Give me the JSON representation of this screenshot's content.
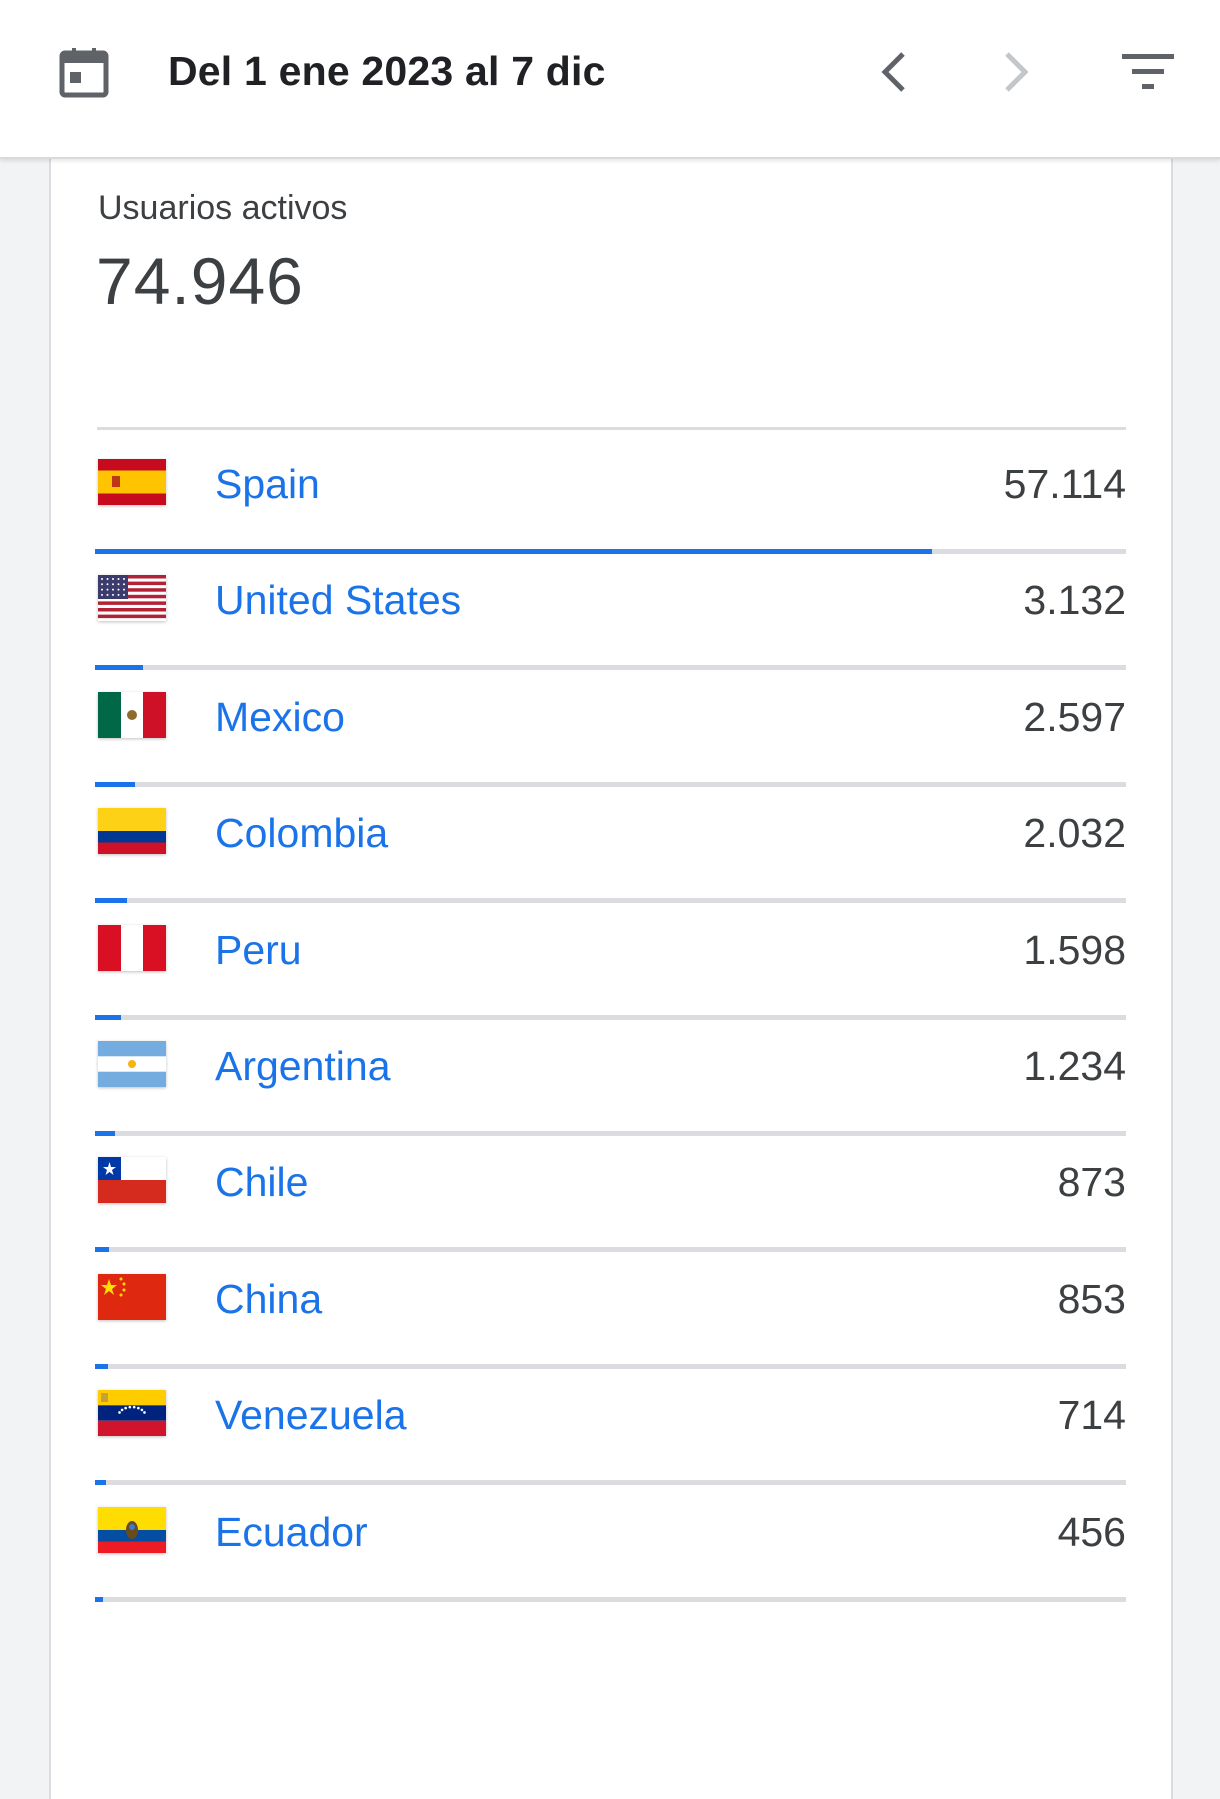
{
  "header": {
    "date_range": "Del 1 ene 2023 al 7 dic",
    "icons": {
      "calendar": "calendar-icon",
      "prev": "chevron-left-icon",
      "next": "chevron-right-icon",
      "filter": "filter-icon"
    }
  },
  "metric": {
    "label": "Usuarios activos",
    "value": "74.946"
  },
  "colors": {
    "accent": "#1a73e8",
    "track": "#dadce0",
    "text": "#3c4043"
  },
  "countries": [
    {
      "name": "Spain",
      "value": "57.114",
      "share": 0.812,
      "flag": "spain-flag-icon"
    },
    {
      "name": "United States",
      "value": "3.132",
      "share": 0.047,
      "flag": "united-states-flag-icon"
    },
    {
      "name": "Mexico",
      "value": "2.597",
      "share": 0.039,
      "flag": "mexico-flag-icon"
    },
    {
      "name": "Colombia",
      "value": "2.032",
      "share": 0.031,
      "flag": "colombia-flag-icon"
    },
    {
      "name": "Peru",
      "value": "1.598",
      "share": 0.025,
      "flag": "peru-flag-icon"
    },
    {
      "name": "Argentina",
      "value": "1.234",
      "share": 0.019,
      "flag": "argentina-flag-icon"
    },
    {
      "name": "Chile",
      "value": "873",
      "share": 0.014,
      "flag": "chile-flag-icon"
    },
    {
      "name": "China",
      "value": "853",
      "share": 0.013,
      "flag": "china-flag-icon"
    },
    {
      "name": "Venezuela",
      "value": "714",
      "share": 0.011,
      "flag": "venezuela-flag-icon"
    },
    {
      "name": "Ecuador",
      "value": "456",
      "share": 0.008,
      "flag": "ecuador-flag-icon"
    }
  ]
}
